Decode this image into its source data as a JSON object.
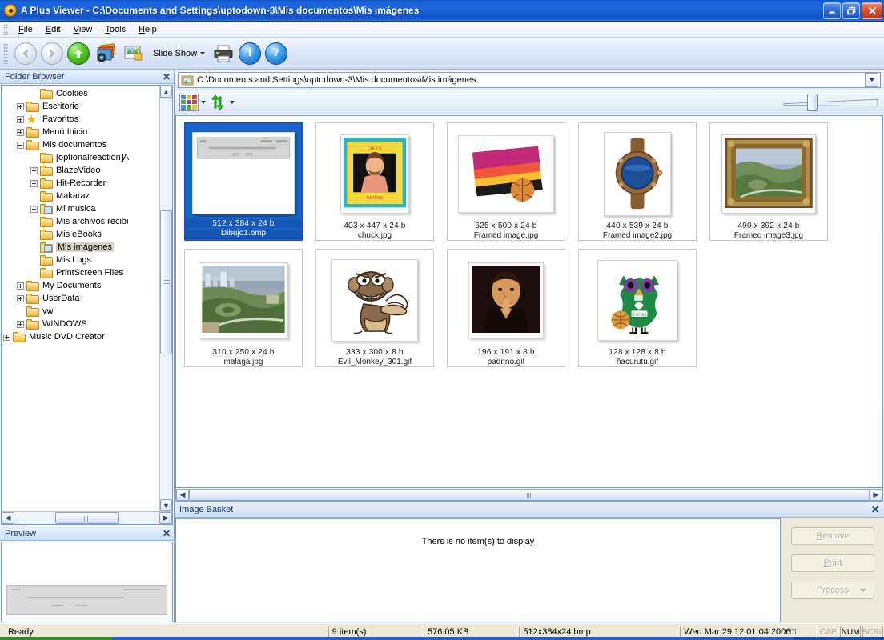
{
  "window": {
    "title": "A Plus Viewer - C:\\Documents and Settings\\uptodown-3\\Mis documentos\\Mis imágenes",
    "minimize": "_",
    "maximize": "❐",
    "close": "✕"
  },
  "menu": {
    "items": [
      {
        "label": "File",
        "mnemonic": "F"
      },
      {
        "label": "Edit",
        "mnemonic": "E"
      },
      {
        "label": "View",
        "mnemonic": "V"
      },
      {
        "label": "Tools",
        "mnemonic": "T"
      },
      {
        "label": "Help",
        "mnemonic": "H"
      }
    ]
  },
  "toolbar": {
    "back": "Back",
    "forward": "Forward",
    "up": "Up",
    "slideshow_label": "Slide Show",
    "print": "Print",
    "info": "i",
    "help": "?"
  },
  "address": {
    "value": "C:\\Documents and Settings\\uptodown-3\\Mis documentos\\Mis imágenes"
  },
  "folder_browser": {
    "title": "Folder Browser",
    "close": "✕",
    "nodes": [
      {
        "label": "Cookies",
        "indent": 2,
        "expander": "none",
        "icon": "folder"
      },
      {
        "label": "Escritorio",
        "indent": 1,
        "expander": "plus",
        "icon": "folder"
      },
      {
        "label": "Favoritos",
        "indent": 1,
        "expander": "plus",
        "icon": "star"
      },
      {
        "label": "Menú Inicio",
        "indent": 1,
        "expander": "plus",
        "icon": "folder"
      },
      {
        "label": "Mis documentos",
        "indent": 1,
        "expander": "minus",
        "icon": "folder"
      },
      {
        "label": "[optionalreaction]A",
        "indent": 2,
        "expander": "none",
        "icon": "folder"
      },
      {
        "label": "BlazeVideo",
        "indent": 2,
        "expander": "plus",
        "icon": "folder"
      },
      {
        "label": "Hit-Recorder",
        "indent": 2,
        "expander": "plus",
        "icon": "folder"
      },
      {
        "label": "Makaraz",
        "indent": 2,
        "expander": "none",
        "icon": "folder"
      },
      {
        "label": "Mi música",
        "indent": 2,
        "expander": "plus",
        "icon": "special"
      },
      {
        "label": "Mis archivos recibi",
        "indent": 2,
        "expander": "none",
        "icon": "folder"
      },
      {
        "label": "Mis eBooks",
        "indent": 2,
        "expander": "none",
        "icon": "folder"
      },
      {
        "label": "Mis imágenes",
        "indent": 2,
        "expander": "none",
        "icon": "special",
        "selected": true
      },
      {
        "label": "Mis Logs",
        "indent": 2,
        "expander": "none",
        "icon": "folder"
      },
      {
        "label": "PrintScreen Files",
        "indent": 2,
        "expander": "none",
        "icon": "folder"
      },
      {
        "label": "My Documents",
        "indent": 1,
        "expander": "plus",
        "icon": "folder"
      },
      {
        "label": "UserData",
        "indent": 1,
        "expander": "plus",
        "icon": "folder"
      },
      {
        "label": "vw",
        "indent": 1,
        "expander": "none",
        "icon": "folder"
      },
      {
        "label": "WINDOWS",
        "indent": 1,
        "expander": "plus",
        "icon": "folder"
      },
      {
        "label": "Music DVD Creator",
        "indent": 0,
        "expander": "plus",
        "icon": "folder"
      }
    ]
  },
  "preview": {
    "title": "Preview",
    "close": "✕"
  },
  "thumbnails": [
    {
      "name": "Dibujo1.bmp",
      "dims": "512 x 384 x 24 b",
      "kind": "document",
      "selected": true
    },
    {
      "name": "chuck.jpg",
      "dims": "403 x 447 x 24 b",
      "kind": "cake"
    },
    {
      "name": "Framed image.jpg",
      "dims": "625 x 500 x 24 b",
      "kind": "sunset-ball"
    },
    {
      "name": "Framed image2.jpg",
      "dims": "440 x 539 x 24 b",
      "kind": "watch"
    },
    {
      "name": "Framed image3.jpg",
      "dims": "490 x 392 x 24 b",
      "kind": "ornate-frame"
    },
    {
      "name": "malaga.jpg",
      "dims": "310 x 250 x 24 b",
      "kind": "cityscape"
    },
    {
      "name": "Evil_Monkey_301.gif",
      "dims": "333 x 300 x 8 b",
      "kind": "monkey"
    },
    {
      "name": "padrino.gif",
      "dims": "196 x 191 x 8 b",
      "kind": "portrait"
    },
    {
      "name": "ñacurutu.gif",
      "dims": "128 x 128 x 8 b",
      "kind": "owl"
    }
  ],
  "basket": {
    "title": "Image Basket",
    "close": "✕",
    "empty_message": "Thers is no item(s) to display",
    "buttons": [
      {
        "label": "Remove",
        "mnemonic": "R",
        "enabled": false
      },
      {
        "label": "Print",
        "mnemonic": "P",
        "enabled": false
      },
      {
        "label": "Process",
        "mnemonic": "P",
        "enabled": false,
        "dropdown": true
      }
    ]
  },
  "statusbar": {
    "ready": "Ready",
    "items": "9 item(s)",
    "size": "576.05 KB",
    "format": "512x384x24 bmp",
    "datetime": "Wed Mar 29 12:01:04 2006□",
    "caps": "CAP",
    "num": "NUM",
    "scrl": "SCRL"
  },
  "colors": {
    "title_blue": "#1a63da",
    "selection_blue": "#1667c9",
    "status_bg": "#ece9d8",
    "panel_blue": "#cddff5"
  }
}
